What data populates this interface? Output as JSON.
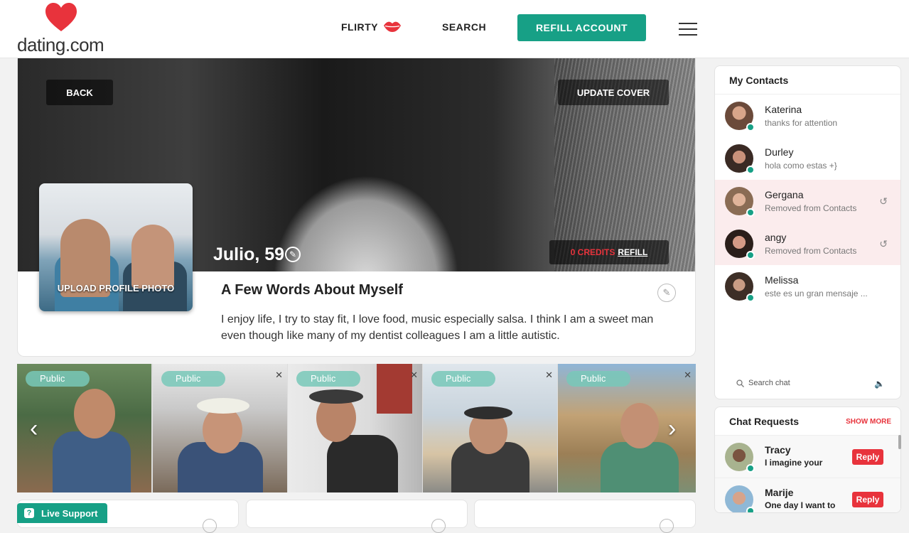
{
  "header": {
    "logo_text": "dating.com",
    "nav_flirty": "FLIRTY",
    "nav_search": "SEARCH",
    "refill_label": "REFILL ACCOUNT"
  },
  "profile": {
    "back_label": "BACK",
    "update_cover_label": "UPDATE COVER",
    "name_age": "Julio, 59",
    "credits": "0 CREDITS",
    "refill_link": "REFILL",
    "upload_photo_label": "UPLOAD PROFILE PHOTO",
    "about_title": "A Few Words About Myself",
    "about_text": "I enjoy life, I try to stay fit, I love food, music especially salsa. I think I am a sweet man even though like many of my dentist colleagues I am a little autistic."
  },
  "photos": [
    {
      "badge": "Public"
    },
    {
      "badge": "Public"
    },
    {
      "badge": "Public"
    },
    {
      "badge": "Public"
    },
    {
      "badge": "Public"
    }
  ],
  "live_support_label": "Live Support",
  "contacts": {
    "title": "My Contacts",
    "items": [
      {
        "name": "Katerina",
        "message": "thanks for attention",
        "removed": false
      },
      {
        "name": "Durley",
        "message": "hola como estas +}",
        "removed": false
      },
      {
        "name": "Gergana",
        "message": "Removed from Contacts",
        "removed": true
      },
      {
        "name": "angy",
        "message": "Removed from Contacts",
        "removed": true
      },
      {
        "name": "Melissa",
        "message": "este es un gran mensaje ...",
        "removed": false
      }
    ],
    "search_placeholder": "Search chat"
  },
  "chat_requests": {
    "title": "Chat Requests",
    "show_more": "SHOW MORE",
    "items": [
      {
        "name": "Tracy",
        "message": "I imagine your",
        "reply_label": "Reply"
      },
      {
        "name": "Marije",
        "message": "One day I want to",
        "reply_label": "Reply"
      }
    ]
  },
  "colors": {
    "accent_green": "#17a086",
    "brand_red": "#e8333c",
    "removed_bg": "#fbeced"
  }
}
